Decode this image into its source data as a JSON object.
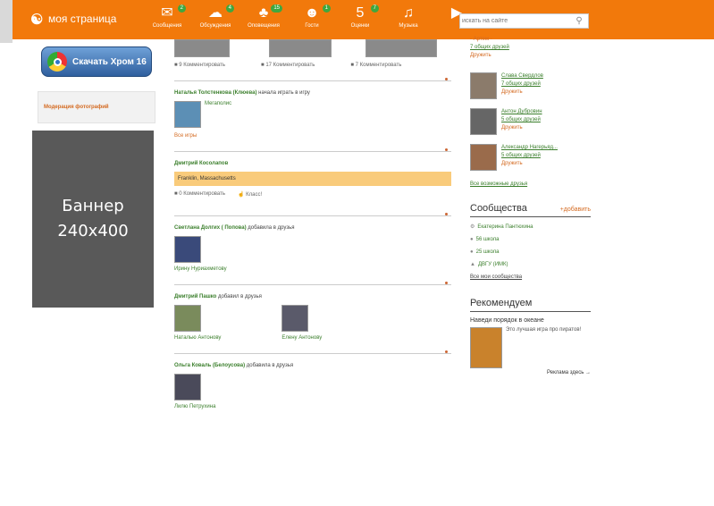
{
  "topbar": {
    "logo_icon": "ok-logo-icon",
    "brand": "моя страница",
    "nav": [
      {
        "icon": "✉",
        "label": "Сообщения",
        "badge": "2"
      },
      {
        "icon": "☁",
        "label": "Обсуждения",
        "badge": "4"
      },
      {
        "icon": "♣",
        "label": "Оповещения",
        "badge": "15"
      },
      {
        "icon": "☻",
        "label": "Гости",
        "badge": "1"
      },
      {
        "icon": "5",
        "label": "Оценки",
        "badge": "7"
      },
      {
        "icon": "♫",
        "label": "Музыка",
        "badge": ""
      },
      {
        "icon": "▶",
        "label": "",
        "badge": ""
      }
    ],
    "search_placeholder": "искать на сайте"
  },
  "left": {
    "chrome_label": "Скачать Хром 16",
    "moderation": "Модерация фотографий",
    "banner_line1": "Баннер",
    "banner_line2": "240x400"
  },
  "feed": {
    "top_actions": [
      "9 Комментировать",
      "17 Комментировать",
      "7 Комментировать"
    ],
    "post1": {
      "author": "Наталья Толстенкова (Клюева)",
      "text": " начала играть в игру",
      "game": "Мегаполис",
      "more": "Все игры"
    },
    "post2": {
      "author": "Дмитрий Косолапов",
      "location": "Franklin, Massachusetts",
      "comment": "0 Комментировать",
      "like": "Класс!"
    },
    "post3": {
      "author": "Светлана Долгих ( Попова)",
      "text": " добавила в друзья",
      "friend": "Ирину Нуриахметову"
    },
    "post4": {
      "author": "Дмитрий Пашко",
      "text": " добавил в друзья",
      "friend1": "Наталью Антонову",
      "friend2": "Елену Антонову"
    },
    "post5": {
      "author": "Ольга Коваль (Белоусова)",
      "text": " добавила в друзья",
      "friend": "Лилю Петрухина"
    }
  },
  "right": {
    "top_name": "- Артем -",
    "top_common": "7 общих друзей",
    "top_add": "Дружить",
    "friends": [
      {
        "name": "Слава Свердлов",
        "common": "7 общих друзей",
        "add": "Дружить"
      },
      {
        "name": "Антон Дубровин",
        "common": "5 общих друзей",
        "add": "Дружить"
      },
      {
        "name": "Александр Нагерьяд...",
        "common": "5 общих друзей",
        "add": "Дружить"
      }
    ],
    "all_friends": "Все возможные друзья",
    "communities_title": "Сообщества",
    "communities_add": "+добавить",
    "communities": [
      "Екатерина Пантюхина",
      "56 школа",
      "25 школа",
      "ДВГУ (ИМК)"
    ],
    "all_communities": "Все мои сообщества",
    "recommend_title": "Рекомендуем",
    "game_title": "Наведи порядок в океане",
    "game_desc": "Это лучшая игра про пиратов!",
    "ad_link": "Реклама здесь →"
  }
}
